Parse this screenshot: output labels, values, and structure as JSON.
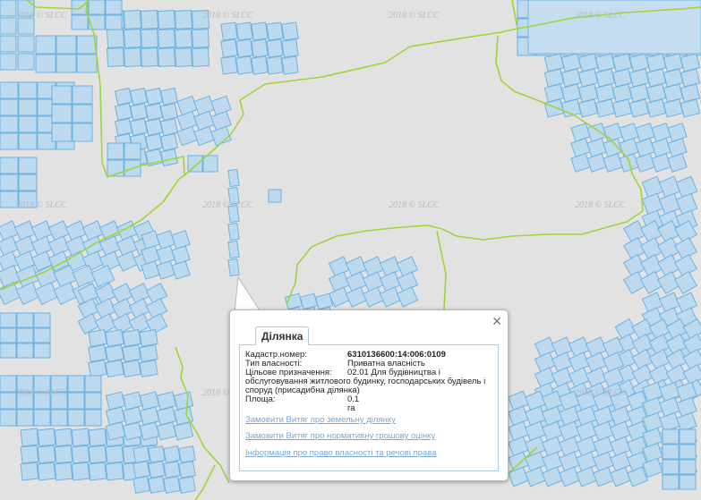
{
  "map": {
    "watermark": "2018 © SLCC",
    "colors": {
      "background": "#e2e2e2",
      "parcel_fill": "#bcd9ee",
      "parcel_stroke": "#6fb3e0",
      "boundary": "#9fd536"
    }
  },
  "popup": {
    "tab_label": "Ділянка",
    "close_icon": "close-icon",
    "fields": {
      "cadastral_label": "Кадастр.номер:",
      "cadastral_value": "6310136600:14:006:0109",
      "ownership_label": "Тип власності:",
      "ownership_value": "Приватна власність",
      "purpose_label": "Цільове призначення:",
      "purpose_value_first": "02.01 Для будівництва і",
      "purpose_value_rest": "обслуговування житлового будинку, господарських будівель і споруд (присадибна ділянка)",
      "area_label": "Площа:",
      "area_value": "0.1 га"
    },
    "links": [
      "Замовити Витяг про земельну ділянку",
      "Замовити Витяг про нормативну грошову оцінку",
      "Інформація про право власності та речові права"
    ]
  }
}
